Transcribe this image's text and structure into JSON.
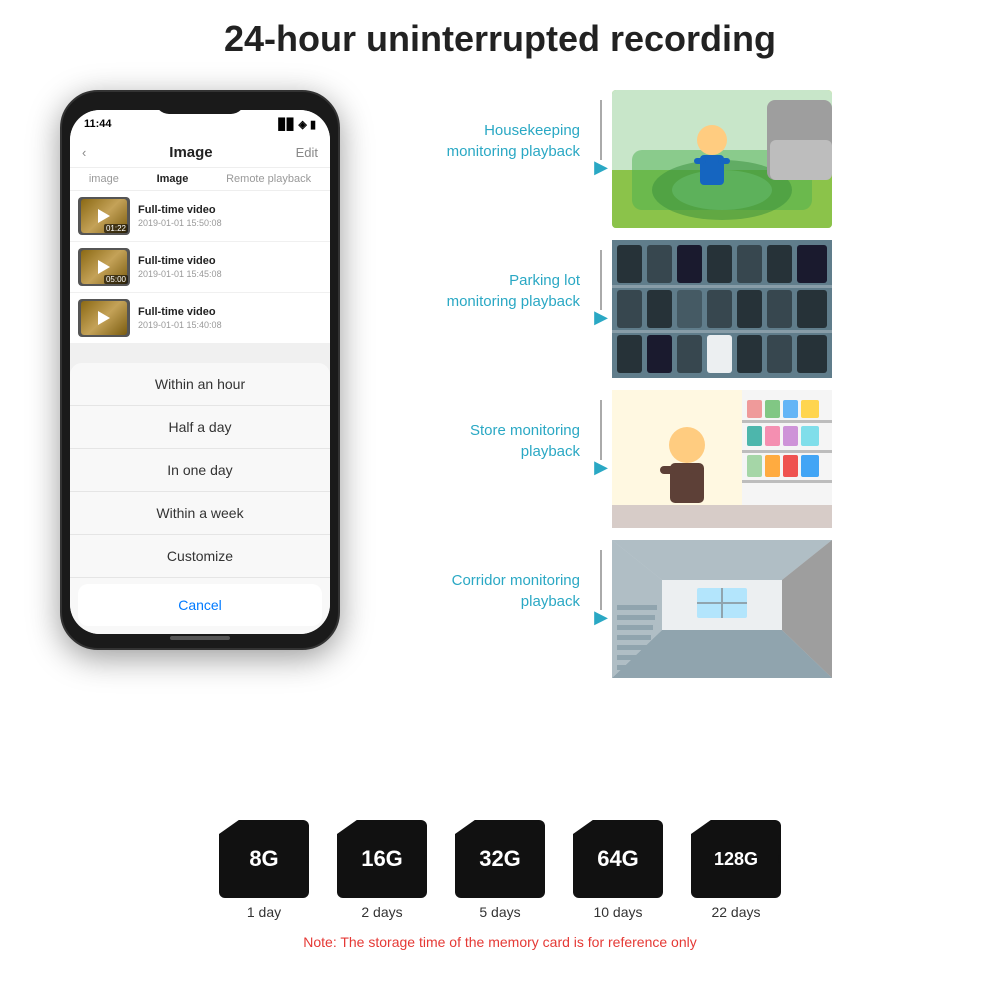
{
  "title": "24-hour uninterrupted recording",
  "phone": {
    "time": "11:44",
    "screen_title": "Image",
    "edit_label": "Edit",
    "back_label": "‹",
    "tabs": [
      "image",
      "Image",
      "Remote playback"
    ],
    "videos": [
      {
        "title": "Full-time video",
        "date": "2019-01-01 15:50:08",
        "duration": "01:22"
      },
      {
        "title": "Full-time video",
        "date": "2019-01-01 15:45:08",
        "duration": "05:00"
      },
      {
        "title": "Full-time video",
        "date": "2019-01-01 15:40:08",
        "duration": ""
      }
    ],
    "sheet_options": [
      "Within an hour",
      "Half a day",
      "In one day",
      "Within a week",
      "Customize"
    ],
    "cancel_label": "Cancel"
  },
  "monitoring": [
    {
      "label": "Housekeeping\nmonitoring playback"
    },
    {
      "label": "Parking lot\nmonitoring playback"
    },
    {
      "label": "Store monitoring\nplayback"
    },
    {
      "label": "Corridor monitoring\nplayback"
    }
  ],
  "sdcards": [
    {
      "size": "8G",
      "days": "1 day"
    },
    {
      "size": "16G",
      "days": "2 days"
    },
    {
      "size": "32G",
      "days": "5 days"
    },
    {
      "size": "64G",
      "days": "10 days"
    },
    {
      "size": "128G",
      "days": "22 days"
    }
  ],
  "note": "Note: The storage time of the memory card is for reference only"
}
